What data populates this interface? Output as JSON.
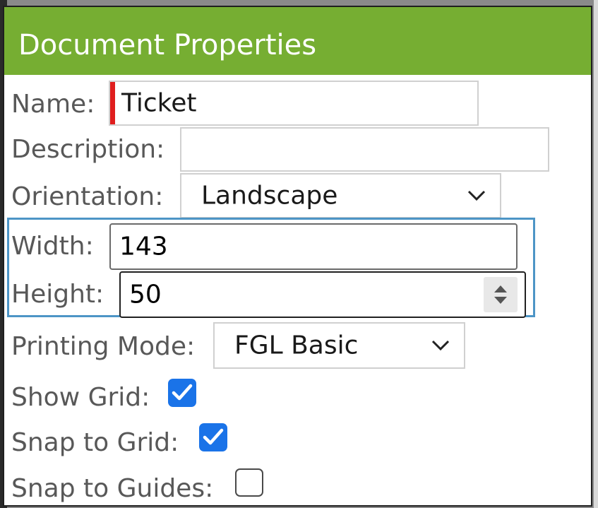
{
  "dialog": {
    "title": "Document Properties"
  },
  "fields": {
    "name": {
      "label": "Name:",
      "value": "Ticket"
    },
    "description": {
      "label": "Description:",
      "value": ""
    },
    "orientation": {
      "label": "Orientation:",
      "value": "Landscape"
    },
    "width": {
      "label": "Width:",
      "value": "143"
    },
    "height": {
      "label": "Height:",
      "value": "50"
    },
    "printing_mode": {
      "label": "Printing Mode:",
      "value": "FGL Basic"
    },
    "show_grid": {
      "label": "Show Grid:",
      "checked": true
    },
    "snap_to_grid": {
      "label": "Snap to Grid:",
      "checked": true
    },
    "snap_to_guides": {
      "label": "Snap to Guides:",
      "checked": false
    }
  },
  "icons": {
    "orientation_dropdown": "chevron-down-icon",
    "printing_mode_dropdown": "chevron-down-icon",
    "height_spinner": "spinner-arrows-icon",
    "check": "checkmark-icon"
  },
  "colors": {
    "header": "#76ae32",
    "required_marker": "#e01e1e",
    "focus_outline": "#4d95c6",
    "checkbox_checked": "#1a73e8"
  }
}
